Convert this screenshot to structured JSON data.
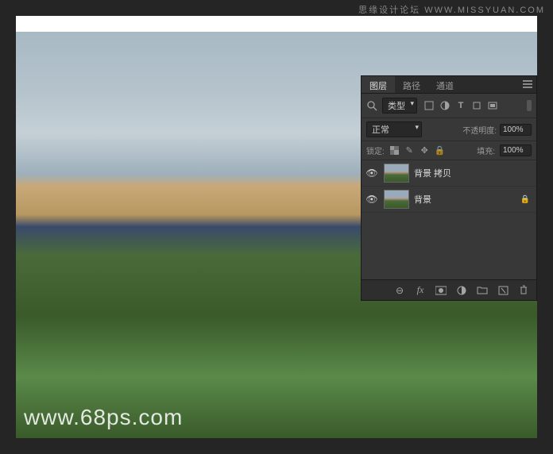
{
  "watermarks": {
    "top": "思缘设计论坛 WWW.MISSYUAN.COM",
    "bottom": "www.68ps.com"
  },
  "panel": {
    "tabs": {
      "layers": "图层",
      "paths": "路径",
      "channels": "通道"
    },
    "filter": {
      "kind": "类型"
    },
    "blend": {
      "mode": "正常",
      "opacityLabel": "不透明度:",
      "opacityValue": "100%"
    },
    "lock": {
      "label": "锁定:",
      "fillLabel": "填充:",
      "fillValue": "100%"
    },
    "layers": [
      {
        "name": "背景 拷贝",
        "visible": true,
        "locked": false
      },
      {
        "name": "背景",
        "visible": true,
        "locked": true
      }
    ]
  }
}
